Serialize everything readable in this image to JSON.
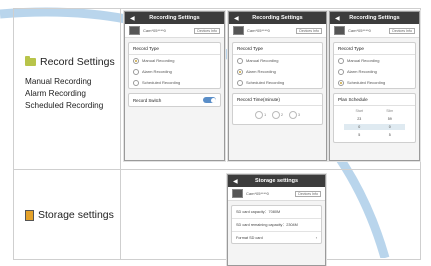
{
  "rows": [
    {
      "title": "Record Settings",
      "icon": "folder-icon",
      "items": [
        "Manual Recording",
        "Alarm Recording",
        "Scheduled Recording"
      ]
    },
    {
      "title": "Storage settings",
      "icon": "sd-card-icon",
      "items": []
    }
  ],
  "screens": {
    "rec_manual": {
      "title": "Recording Settings",
      "device_name": "Cam*05****0",
      "device_button": "Devices Info",
      "section_header": "Record Type",
      "options": [
        "Manual Recording",
        "Alarm Recording",
        "Scheduled Recording"
      ],
      "selected": 0,
      "switch_label": "Record Switch",
      "switch_on": true
    },
    "rec_alarm": {
      "title": "Recording Settings",
      "device_name": "Cam*05****0",
      "device_button": "Devices Info",
      "section_header": "Record Type",
      "options": [
        "Manual Recording",
        "Alarm Recording",
        "Scheduled Recording"
      ],
      "selected": 1,
      "section2_header": "Record Time(minute)",
      "time_options": [
        "1",
        "2",
        "3"
      ]
    },
    "rec_schedule": {
      "title": "Recording Settings",
      "device_name": "Cam*05****0",
      "device_button": "Devices Info",
      "section_header": "Record Type",
      "options": [
        "Manual Recording",
        "Alarm Recording",
        "Scheduled Recording"
      ],
      "selected": 2,
      "section2_header": "Plan Schedule",
      "plan_headers": [
        "Start",
        "Slim"
      ],
      "plan_rows": [
        [
          "23",
          "59"
        ],
        [
          "0",
          "0"
        ],
        [
          "5",
          "5"
        ]
      ]
    },
    "storage": {
      "title": "Storage settings",
      "device_name": "Cam*05****0",
      "device_button": "Devices Info",
      "rows": [
        "SD card capacity：7080M",
        "SD card remaining capacity：2304M",
        "Format SD card"
      ]
    }
  },
  "colors": {
    "title_bar": "#3c3c3c",
    "toggle_on": "#5a8ec8",
    "radio_selected": "#c9a43a",
    "watermark": "#7fb3dd"
  }
}
